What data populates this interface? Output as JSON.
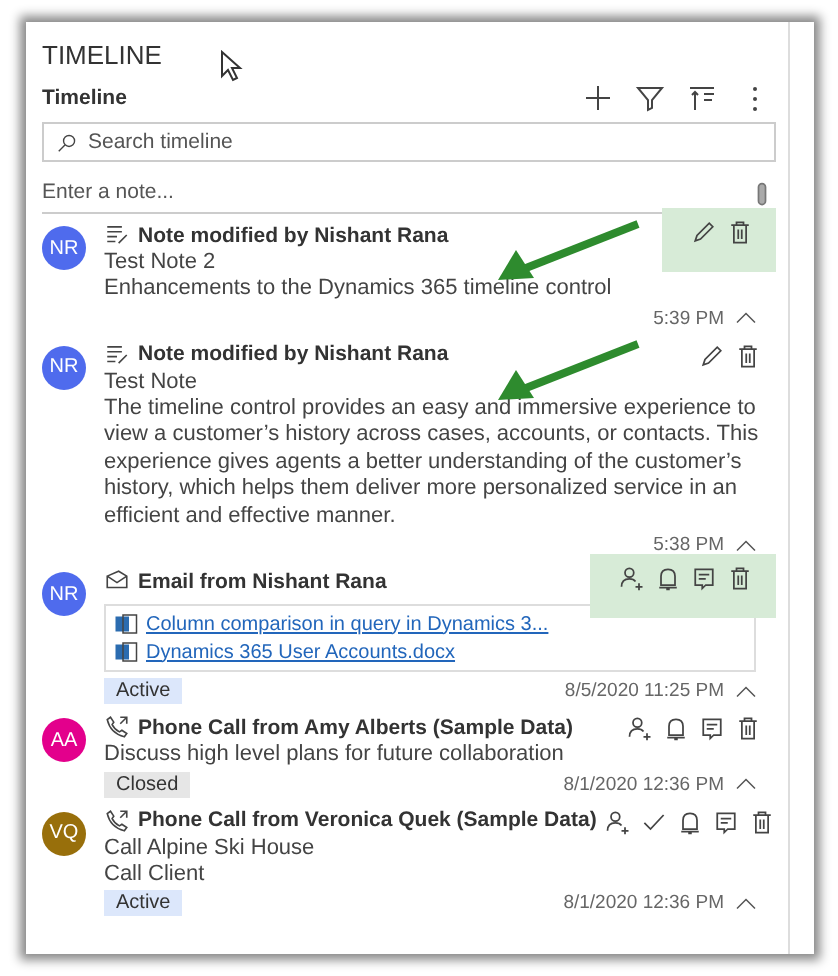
{
  "section_title": "TIMELINE",
  "header": {
    "title": "Timeline"
  },
  "search": {
    "placeholder": "Search timeline"
  },
  "note_entry": {
    "placeholder": "Enter a note..."
  },
  "items": [
    {
      "kind": "note",
      "initials": "NR",
      "color": "#4f6bed",
      "title": "Note modified by Nishant Rana",
      "subtitle": "Test Note 2",
      "body": "Enhancements to the Dynamics 365 timeline control",
      "time": "5:39 PM",
      "actions": [
        {
          "kind": "edit"
        },
        {
          "kind": "delete"
        }
      ],
      "highlighted": true,
      "arrow": true
    },
    {
      "kind": "note",
      "initials": "NR",
      "color": "#4f6bed",
      "title": "Note modified by Nishant Rana",
      "subtitle": "Test Note",
      "body": "The timeline control provides an easy and immersive experience to view a customer’s history across cases, accounts, or contacts. This experience gives agents a better understanding of the customer’s history, which helps them deliver more personalized service in an efficient and effective manner.",
      "time": "5:38 PM",
      "actions": [
        {
          "kind": "edit"
        },
        {
          "kind": "delete"
        }
      ],
      "highlighted": false,
      "arrow": true
    },
    {
      "kind": "email",
      "initials": "NR",
      "color": "#4f6bed",
      "title": "Email from Nishant Rana",
      "attachments": [
        "Column comparison in query in Dynamics 3...",
        "Dynamics 365 User Accounts.docx"
      ],
      "status": {
        "label": "Active",
        "kind": "active"
      },
      "time": "8/5/2020 11:25 PM",
      "actions": [
        {
          "kind": "assign"
        },
        {
          "kind": "queue"
        },
        {
          "kind": "open"
        },
        {
          "kind": "delete"
        }
      ],
      "highlighted": true,
      "arrow": false
    },
    {
      "kind": "phone",
      "initials": "AA",
      "color": "#e3008c",
      "title": "Phone Call from Amy Alberts (Sample Data)",
      "body": "Discuss high level plans for future collaboration",
      "status": {
        "label": "Closed",
        "kind": "closed"
      },
      "time": "8/1/2020 12:36 PM",
      "actions": [
        {
          "kind": "assign"
        },
        {
          "kind": "queue"
        },
        {
          "kind": "open"
        },
        {
          "kind": "delete"
        }
      ],
      "highlighted": false,
      "arrow": false
    },
    {
      "kind": "phone",
      "initials": "VQ",
      "color": "#986f0b",
      "title": "Phone Call from Veronica Quek (Sample Data)",
      "subtitle": "Call Alpine Ski House",
      "body": "Call Client",
      "status": {
        "label": "Active",
        "kind": "active"
      },
      "time": "8/1/2020 12:36 PM",
      "actions": [
        {
          "kind": "assign"
        },
        {
          "kind": "close"
        },
        {
          "kind": "queue"
        },
        {
          "kind": "open"
        },
        {
          "kind": "delete"
        }
      ],
      "highlighted": false,
      "arrow": false
    }
  ]
}
